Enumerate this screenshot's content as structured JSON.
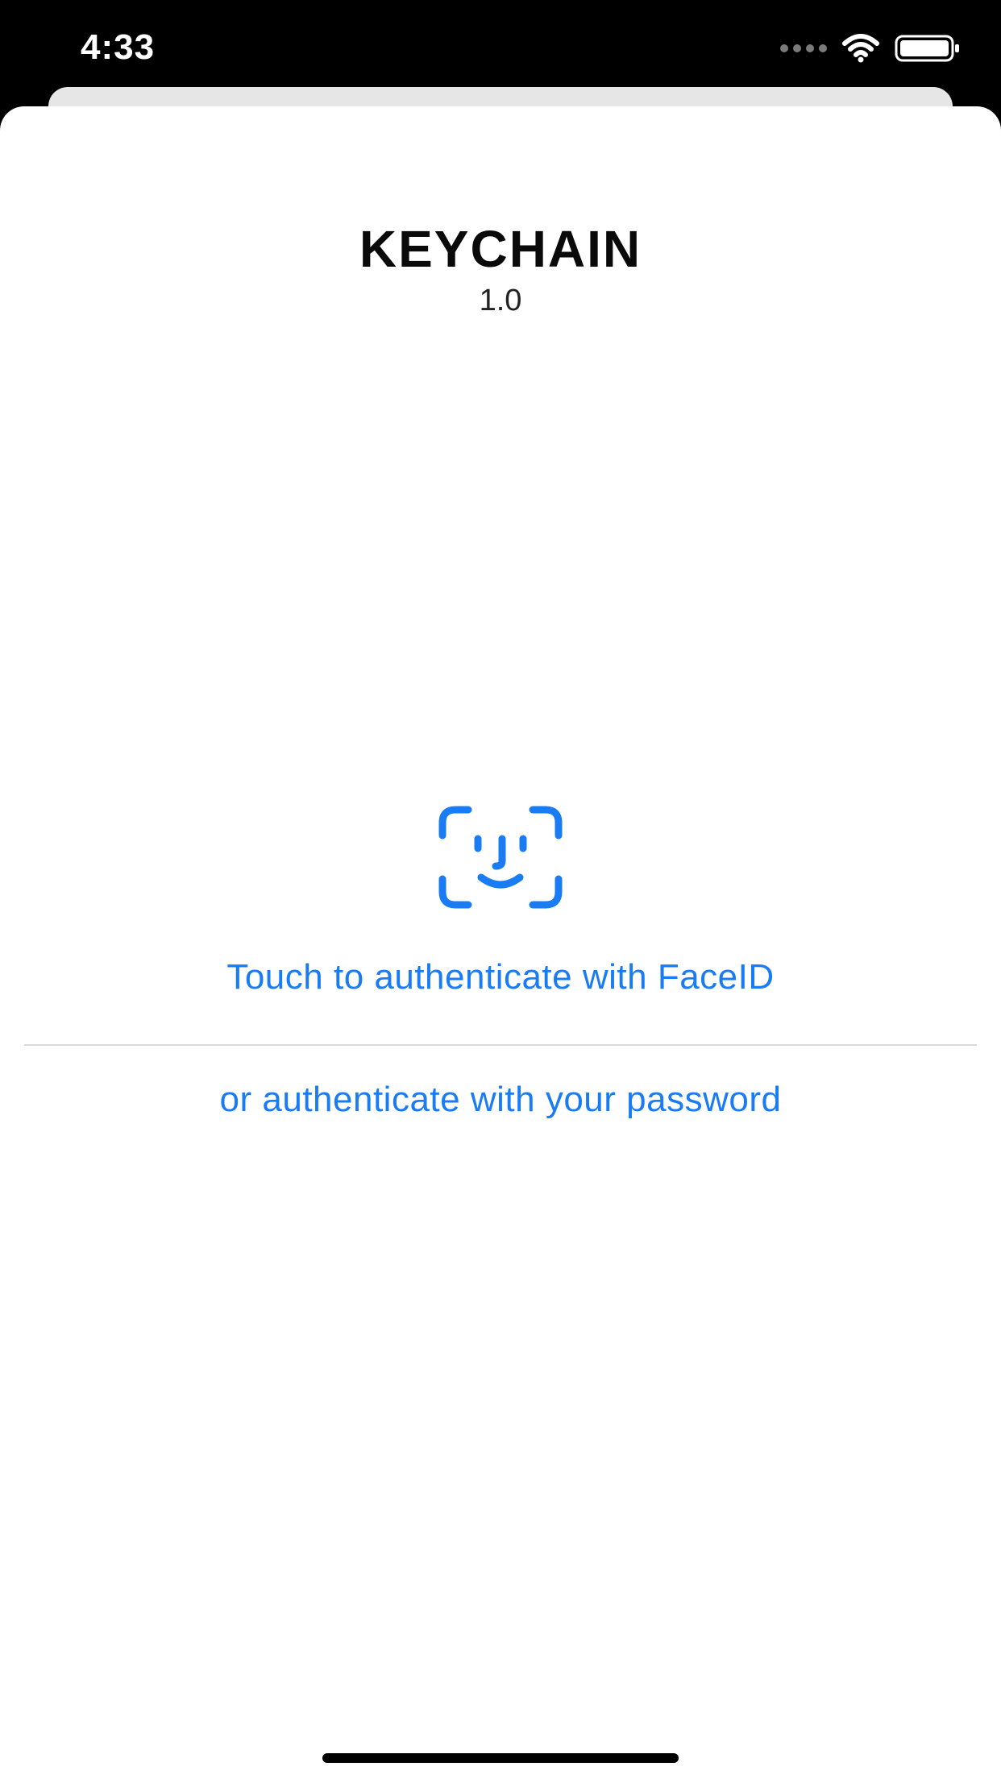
{
  "status_bar": {
    "time": "4:33",
    "signal_icon": "signal-dots-icon",
    "wifi_icon": "wifi-icon",
    "battery_icon": "battery-icon"
  },
  "app": {
    "title": "KEYCHAIN",
    "version": "1.0"
  },
  "auth": {
    "faceid_icon": "faceid-icon",
    "faceid_label": "Touch to authenticate with FaceID",
    "password_label": "or authenticate with your password"
  },
  "colors": {
    "accent": "#1a7cf5",
    "background": "#ffffff",
    "status_bar": "#000000"
  }
}
